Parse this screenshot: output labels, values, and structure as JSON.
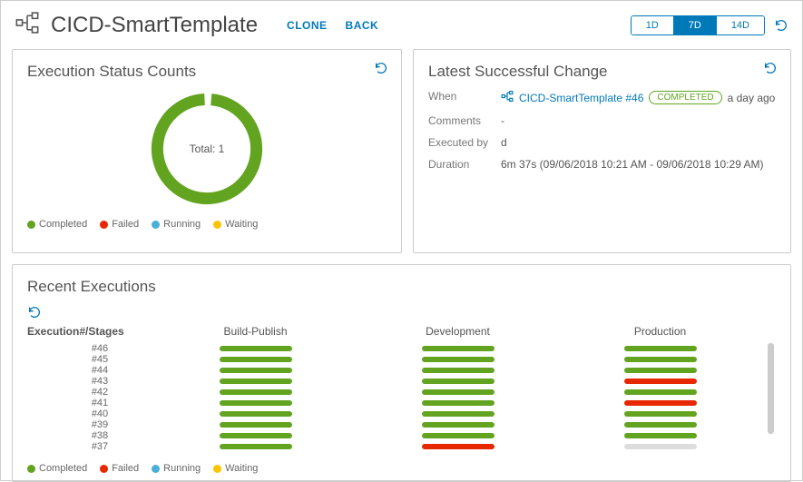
{
  "header": {
    "title": "CICD-SmartTemplate",
    "clone": "CLONE",
    "back": "BACK",
    "range": {
      "opt1": "1D",
      "opt2": "7D",
      "opt3": "14D",
      "active": "7D"
    }
  },
  "status_panel": {
    "title": "Execution Status Counts",
    "total_label": "Total: 1",
    "legend": {
      "completed": "Completed",
      "failed": "Failed",
      "running": "Running",
      "waiting": "Waiting"
    }
  },
  "change_panel": {
    "title": "Latest Successful Change",
    "labels": {
      "when": "When",
      "comments": "Comments",
      "executed_by": "Executed by",
      "duration": "Duration"
    },
    "when_link": "CICD-SmartTemplate #46",
    "when_badge": "COMPLETED",
    "when_ago": "a day ago",
    "comments": "-",
    "executed_by": "d",
    "duration": "6m 37s (09/06/2018 10:21 AM - 09/06/2018 10:29 AM)"
  },
  "recent": {
    "title": "Recent Executions",
    "col_exec": "Execution#/Stages",
    "col1": "Build-Publish",
    "col2": "Development",
    "col3": "Production",
    "legend": {
      "completed": "Completed",
      "failed": "Failed",
      "running": "Running",
      "waiting": "Waiting"
    },
    "rows": [
      {
        "num": "#46",
        "s1": "completed",
        "s2": "completed",
        "s3": "completed"
      },
      {
        "num": "#45",
        "s1": "completed",
        "s2": "completed",
        "s3": "completed"
      },
      {
        "num": "#44",
        "s1": "completed",
        "s2": "completed",
        "s3": "completed"
      },
      {
        "num": "#43",
        "s1": "completed",
        "s2": "completed",
        "s3": "failed"
      },
      {
        "num": "#42",
        "s1": "completed",
        "s2": "completed",
        "s3": "completed"
      },
      {
        "num": "#41",
        "s1": "completed",
        "s2": "completed",
        "s3": "failed"
      },
      {
        "num": "#40",
        "s1": "completed",
        "s2": "completed",
        "s3": "completed"
      },
      {
        "num": "#39",
        "s1": "completed",
        "s2": "completed",
        "s3": "completed"
      },
      {
        "num": "#38",
        "s1": "completed",
        "s2": "completed",
        "s3": "completed"
      },
      {
        "num": "#37",
        "s1": "completed",
        "s2": "failed",
        "s3": "waiting"
      }
    ]
  },
  "chart_data": {
    "type": "pie",
    "title": "Execution Status Counts",
    "categories": [
      "Completed",
      "Failed",
      "Running",
      "Waiting"
    ],
    "values": [
      1,
      0,
      0,
      0
    ],
    "total": 1,
    "colors": {
      "Completed": "#62a420",
      "Failed": "#e62700",
      "Running": "#49afd9",
      "Waiting": "#fac400"
    }
  }
}
